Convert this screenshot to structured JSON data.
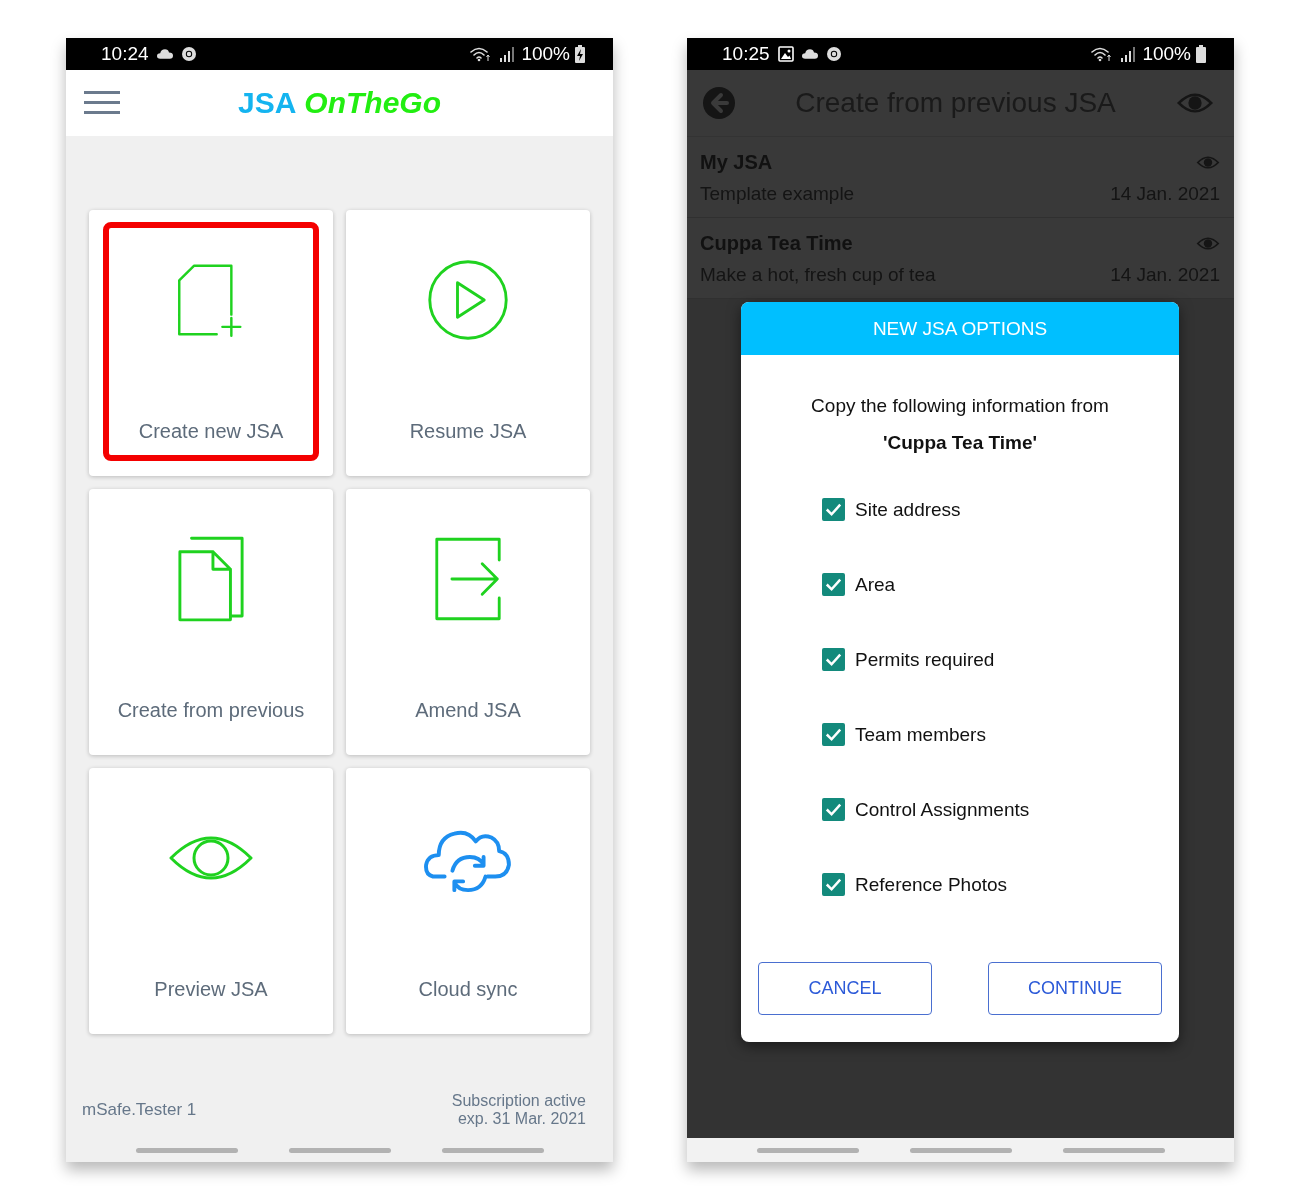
{
  "left_phone": {
    "status_bar": {
      "time": "10:24",
      "battery": "100%"
    },
    "app_bar": {
      "title": "JSA",
      "title_accent": "OnTheGo"
    },
    "tiles": [
      {
        "kind": "new",
        "label": "Create new JSA",
        "highlighted": true
      },
      {
        "kind": "resume",
        "label": "Resume JSA",
        "highlighted": false
      },
      {
        "kind": "copy",
        "label": "Create from previous",
        "highlighted": false
      },
      {
        "kind": "amend",
        "label": "Amend JSA",
        "highlighted": false
      },
      {
        "kind": "preview",
        "label": "Preview JSA",
        "highlighted": false
      },
      {
        "kind": "sync",
        "label": "Cloud sync",
        "highlighted": false
      }
    ],
    "footer": {
      "user": "mSafe.Tester 1",
      "subscription": "Subscription active",
      "expiry": "exp. 31 Mar. 2021"
    }
  },
  "right_phone": {
    "status_bar": {
      "time": "10:25",
      "battery": "100%"
    },
    "app_bar": {
      "title": "Create from previous JSA"
    },
    "list": [
      {
        "title": "My JSA",
        "subtitle": "Template example",
        "date": "14 Jan. 2021"
      },
      {
        "title": "Cuppa Tea Time",
        "subtitle": "Make a hot, fresh cup of tea",
        "date": "14 Jan. 2021"
      }
    ],
    "dialog": {
      "title": "NEW JSA OPTIONS",
      "message": "Copy the following information from",
      "source": "'Cuppa Tea Time'",
      "options": [
        {
          "label": "Site address",
          "checked": true
        },
        {
          "label": "Area",
          "checked": true
        },
        {
          "label": "Permits required",
          "checked": true
        },
        {
          "label": "Team members",
          "checked": true
        },
        {
          "label": "Control Assignments",
          "checked": true
        },
        {
          "label": "Reference Photos",
          "checked": true
        }
      ],
      "buttons": [
        {
          "label": "CANCEL"
        },
        {
          "label": "CONTINUE"
        }
      ]
    }
  }
}
